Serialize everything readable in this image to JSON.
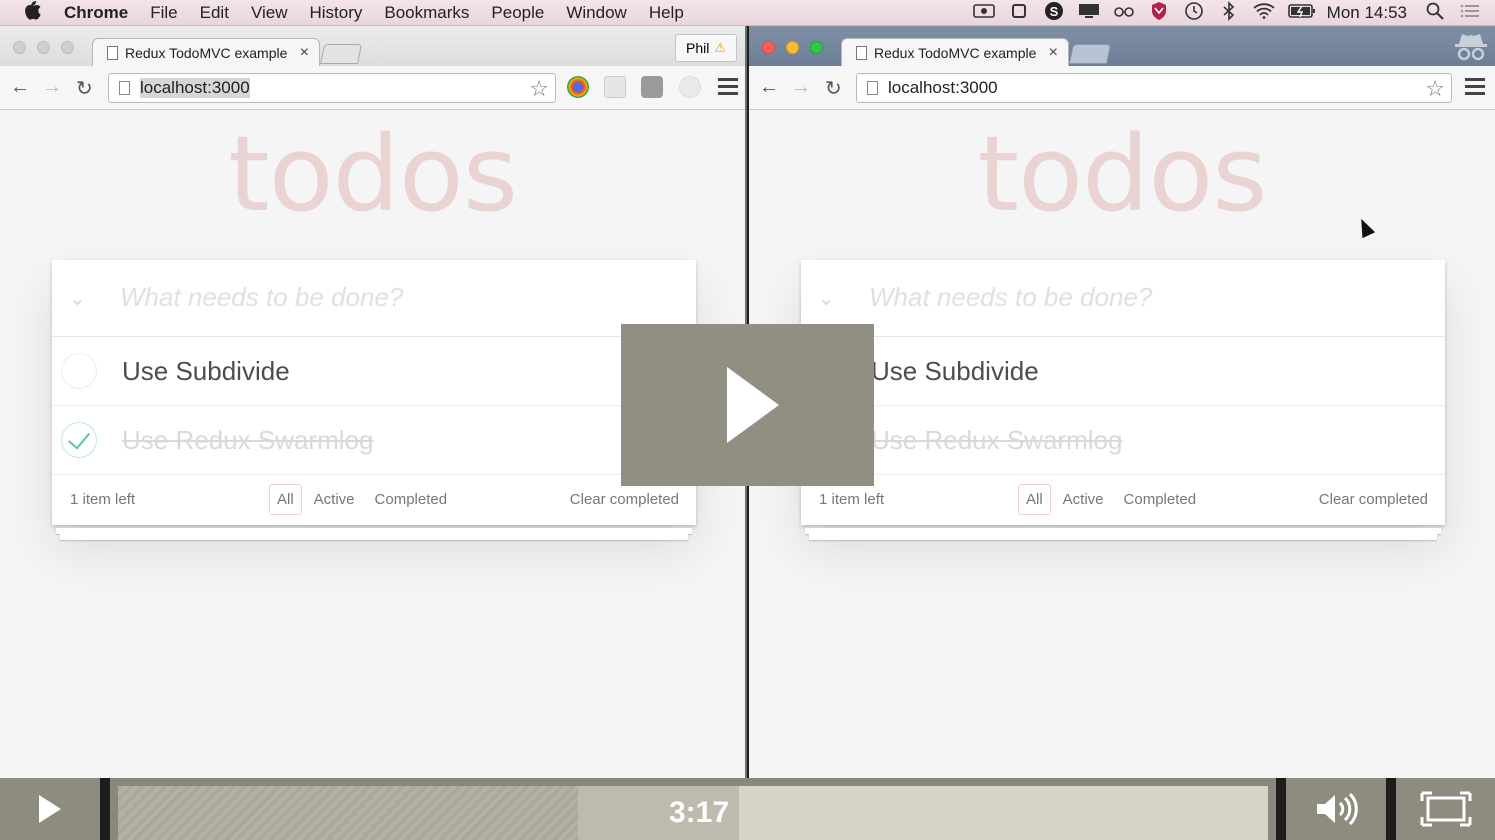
{
  "menubar": {
    "apple": "",
    "items": [
      "Chrome",
      "File",
      "Edit",
      "View",
      "History",
      "Bookmarks",
      "People",
      "Window",
      "Help"
    ],
    "clock": "Mon 14:53"
  },
  "left_window": {
    "tab_title": "Redux TodoMVC example",
    "tab_close": "×",
    "profile": "Phil",
    "profile_warning": "⚠",
    "url_host": "localhost",
    "url_port": ":3000"
  },
  "right_window": {
    "tab_title": "Redux TodoMVC example",
    "tab_close": "×",
    "url": "localhost:3000"
  },
  "todo_app": {
    "title": "todos",
    "toggle_all": "⌄",
    "input_placeholder": "What needs to be done?",
    "items": [
      {
        "label": "Use Subdivide",
        "completed": false
      },
      {
        "label": "Use Redux Swarmlog",
        "completed": true
      }
    ],
    "count": "1 item left",
    "filters": {
      "all": "All",
      "active": "Active",
      "completed": "Completed"
    },
    "selected_filter": "All",
    "clear_completed": "Clear completed",
    "accent_color": "#af2f2f",
    "check_color": "#5dc2af"
  },
  "nav_icons": {
    "back": "←",
    "forward": "→",
    "reload": "↻",
    "star": "☆"
  },
  "video": {
    "current_time": "3:17",
    "played_fraction": 0.54,
    "buffered_fraction": 0.4,
    "accent_color": "#8e8c7f"
  }
}
